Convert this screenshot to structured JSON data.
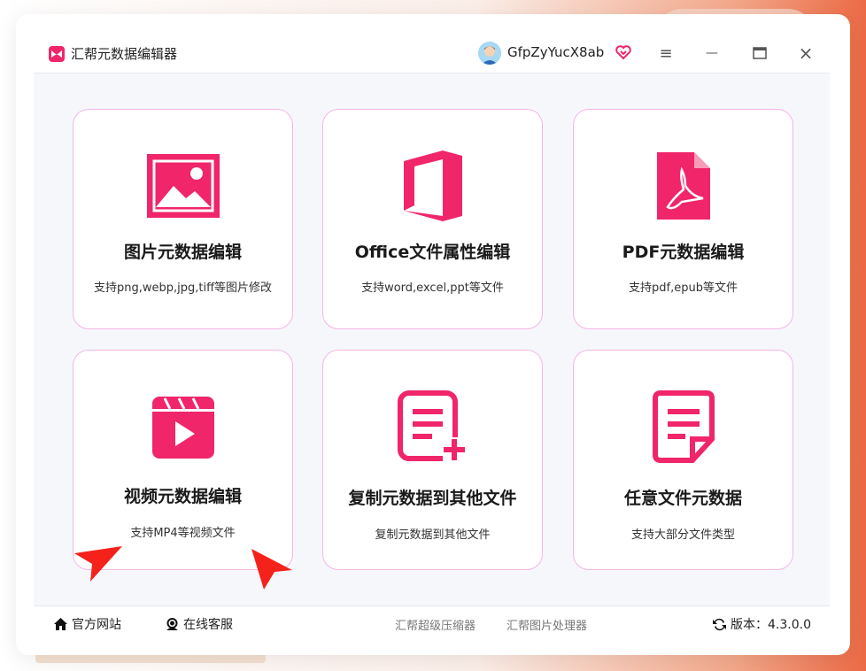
{
  "app": {
    "title": "汇帮元数据编辑器",
    "username": "GfpZyYucX8ab",
    "brand_color": "#f0256a"
  },
  "window_controls": {
    "menu": "≡",
    "minimize": "—",
    "maximize": "▭",
    "close": "×"
  },
  "cards": [
    {
      "title": "图片元数据编辑",
      "desc": "支持png,webp,jpg,tiff等图片修改",
      "icon": "image-icon"
    },
    {
      "title": "Office文件属性编辑",
      "desc": "支持word,excel,ppt等文件",
      "icon": "office-icon"
    },
    {
      "title": "PDF元数据编辑",
      "desc": "支持pdf,epub等文件",
      "icon": "pdf-icon"
    },
    {
      "title": "视频元数据编辑",
      "desc": "支持MP4等视频文件",
      "icon": "video-icon"
    },
    {
      "title": "复制元数据到其他文件",
      "desc": "复制元数据到其他文件",
      "icon": "copy-doc-icon"
    },
    {
      "title": "任意文件元数据",
      "desc": "支持大部分文件类型",
      "icon": "document-icon"
    }
  ],
  "footer": {
    "website": "官方网站",
    "support": "在线客服",
    "link1": "汇帮超级压缩器",
    "link2": "汇帮图片处理器",
    "version_label": "版本：4.3.0.0"
  }
}
